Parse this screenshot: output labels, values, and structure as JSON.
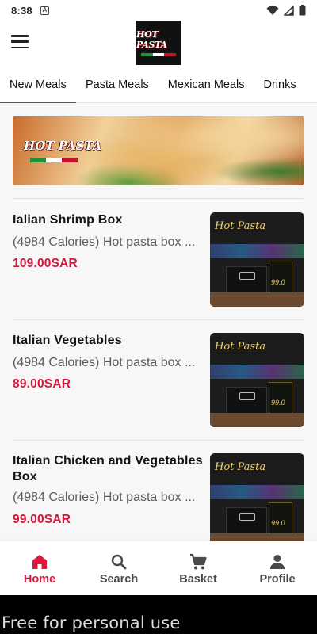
{
  "status_bar": {
    "time": "8:38",
    "notification_letter": "A"
  },
  "app_bar": {
    "logo_text": "HOT PASTA"
  },
  "colors": {
    "accent": "#e0173b",
    "price": "#d8163a",
    "flag_green": "#1f8f3a",
    "flag_white": "#ffffff",
    "flag_red": "#c8102e"
  },
  "tabs": [
    {
      "label": "New Meals",
      "active": true
    },
    {
      "label": "Pasta Meals",
      "active": false
    },
    {
      "label": "Mexican Meals",
      "active": false
    },
    {
      "label": "Drinks",
      "active": false
    }
  ],
  "banner": {
    "logo_text": "HOT PASTA"
  },
  "items": [
    {
      "name": "Ialian Shrimp Box",
      "description": "(4984 Calories) Hot pasta box ...",
      "price": "109.00SAR",
      "sign": "Hot Pasta"
    },
    {
      "name": "Italian Vegetables",
      "description": "(4984 Calories) Hot pasta box ...",
      "price": "89.00SAR",
      "sign": "Hot Pasta"
    },
    {
      "name": "Italian Chicken and Vegetables Box",
      "description": "(4984 Calories) Hot pasta box ...",
      "price": "99.00SAR",
      "sign": "Hot Pasta"
    }
  ],
  "bottom_nav": [
    {
      "label": "Home",
      "icon": "home-icon",
      "active": true
    },
    {
      "label": "Search",
      "icon": "search-icon",
      "active": false
    },
    {
      "label": "Basket",
      "icon": "basket-icon",
      "active": false
    },
    {
      "label": "Profile",
      "icon": "profile-icon",
      "active": false
    }
  ],
  "watermark": "Free for personal use"
}
